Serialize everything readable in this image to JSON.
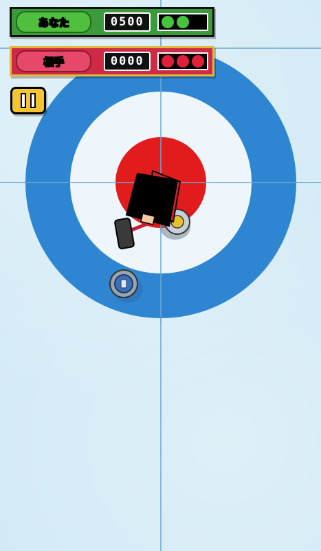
{
  "player": {
    "name": "あなた",
    "score": "0500",
    "stones": [
      {
        "state": "remaining",
        "color": "#46c43c"
      },
      {
        "state": "remaining",
        "color": "#46c43c"
      },
      {
        "state": "used",
        "color": "#000000"
      }
    ],
    "color": "#3c9a3a"
  },
  "opponent": {
    "name": "相手",
    "score": "0000",
    "stones": [
      {
        "state": "remaining",
        "color": "#e0203a"
      },
      {
        "state": "remaining",
        "color": "#e0203a"
      },
      {
        "state": "remaining",
        "color": "#e0203a"
      }
    ],
    "color": "#cf2a45"
  },
  "controls": {
    "pause_icon": "pause-icon"
  },
  "house": {
    "outer_ring_color": "#2e86d2",
    "middle_ring_color": "#f3f8fb",
    "button_color": "#e21c1c",
    "ice_color": "#d3eaf6"
  },
  "stones_on_ice": [
    {
      "team": "player",
      "color": "#3b6fb8",
      "icon": "blue-curling-stone-icon"
    },
    {
      "team": "opponent",
      "icon": "broom-sweeper-character-icon"
    }
  ]
}
